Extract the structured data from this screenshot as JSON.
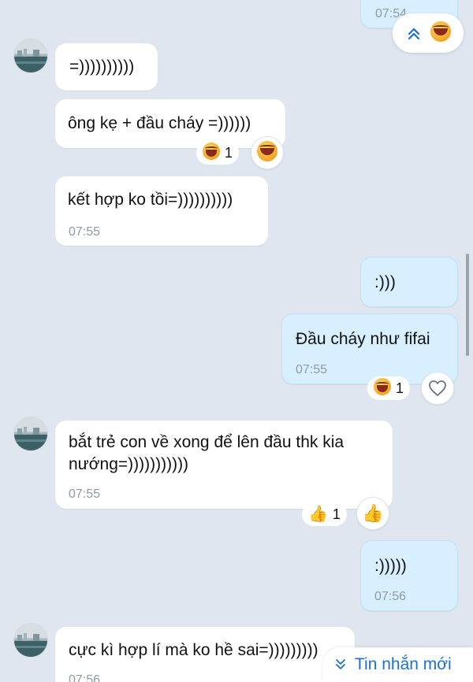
{
  "messages": {
    "m0": {
      "time": "07:54"
    },
    "m1": {
      "text": "=))))))))))"
    },
    "m2": {
      "text": "ông kẹ + đầu cháy =))))))",
      "reaction_count": "1"
    },
    "m3": {
      "text": "kết hợp ko tồi=))))))))))",
      "time": "07:55"
    },
    "m4": {
      "text": ":)))"
    },
    "m5": {
      "text": "Đầu cháy như fifai",
      "time": "07:55",
      "reaction_count": "1"
    },
    "m6": {
      "text_line1": "bắt trẻ con về xong để lên đầu thk kia",
      "text_line2": "nướng=)))))))))))",
      "time": "07:55",
      "reaction_count": "1"
    },
    "m7": {
      "text": ":)))))",
      "time": "07:56"
    },
    "m8": {
      "text": "cực kì hợp lí mà ko hề sai=)))))))))",
      "time": "07:56"
    }
  },
  "new_messages_button": {
    "label": "Tin nhắn mới"
  },
  "icons": {
    "scroll_up": "double-chevron-up-icon",
    "reaction_laugh": "laughing-emoji-icon",
    "reaction_like": "thumbs-up-emoji-icon",
    "reaction_heart": "heart-outline-icon",
    "chevron_down": "double-chevron-down-icon"
  },
  "colors": {
    "background": "#dfe6ef",
    "incoming_bubble": "#ffffff",
    "outgoing_bubble": "#d8efff",
    "accent": "#1b6fd8",
    "timestamp": "#8e9aa6"
  }
}
